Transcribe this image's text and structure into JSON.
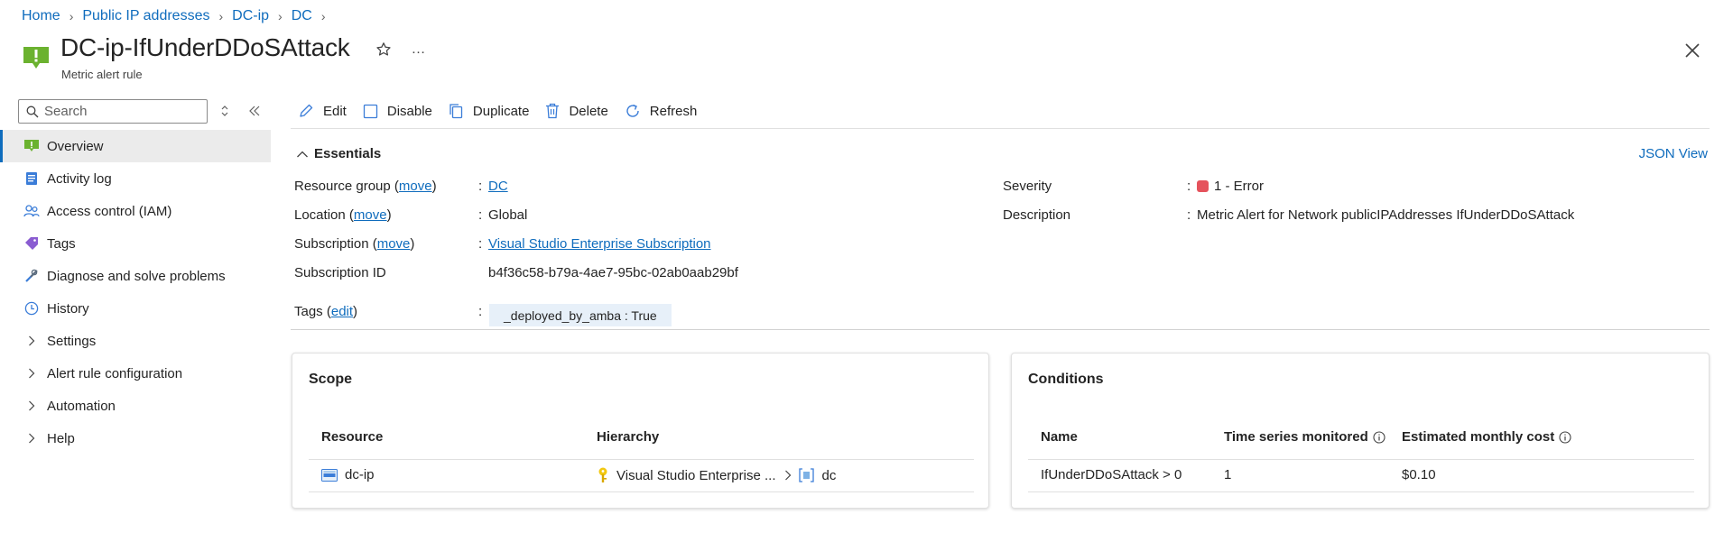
{
  "breadcrumb": [
    "Home",
    "Public IP addresses",
    "DC-ip",
    "DC"
  ],
  "header": {
    "title": "DC-ip-IfUnderDDoSAttack",
    "subtitle": "Metric alert rule"
  },
  "sidebar": {
    "search_placeholder": "Search",
    "items": [
      {
        "label": "Overview",
        "icon": "alert-rule-icon",
        "active": true
      },
      {
        "label": "Activity log",
        "icon": "activity-log-icon"
      },
      {
        "label": "Access control (IAM)",
        "icon": "people-icon"
      },
      {
        "label": "Tags",
        "icon": "tag-icon"
      },
      {
        "label": "Diagnose and solve problems",
        "icon": "wrench-icon"
      },
      {
        "label": "History",
        "icon": "clock-icon"
      },
      {
        "label": "Settings",
        "icon": "chevron-right-icon"
      },
      {
        "label": "Alert rule configuration",
        "icon": "chevron-right-icon"
      },
      {
        "label": "Automation",
        "icon": "chevron-right-icon"
      },
      {
        "label": "Help",
        "icon": "chevron-right-icon"
      }
    ]
  },
  "toolbar": {
    "edit": "Edit",
    "disable": "Disable",
    "duplicate": "Duplicate",
    "delete": "Delete",
    "refresh": "Refresh"
  },
  "essentials": {
    "heading": "Essentials",
    "json_view": "JSON View",
    "move": "move",
    "edit": "edit",
    "resource_group": {
      "label": "Resource group",
      "value": "DC"
    },
    "location": {
      "label": "Location",
      "value": "Global"
    },
    "subscription": {
      "label": "Subscription",
      "value": "Visual Studio Enterprise Subscription"
    },
    "subscription_id": {
      "label": "Subscription ID",
      "value": "b4f36c58-b79a-4ae7-95bc-02ab0aab29bf"
    },
    "tags": {
      "label": "Tags",
      "value": "_deployed_by_amba : True"
    },
    "severity": {
      "label": "Severity",
      "value": "1 - Error",
      "color": "#e5525c"
    },
    "description": {
      "label": "Description",
      "value": "Metric Alert for Network publicIPAddresses IfUnderDDoSAttack"
    }
  },
  "scope": {
    "title": "Scope",
    "columns": [
      "Resource",
      "Hierarchy"
    ],
    "rows": [
      {
        "resource": "dc-ip",
        "hierarchy_subscription": "Visual Studio Enterprise ...",
        "hierarchy_rg": "dc"
      }
    ]
  },
  "conditions": {
    "title": "Conditions",
    "columns": [
      "Name",
      "Time series monitored",
      "Estimated monthly cost"
    ],
    "rows": [
      {
        "name": "IfUnderDDoSAttack > 0",
        "time_series": "1",
        "cost": "$0.10"
      }
    ]
  },
  "colors": {
    "accent": "#0f6cbd",
    "alert_green": "#6bb22f",
    "error_red": "#e5525c"
  }
}
